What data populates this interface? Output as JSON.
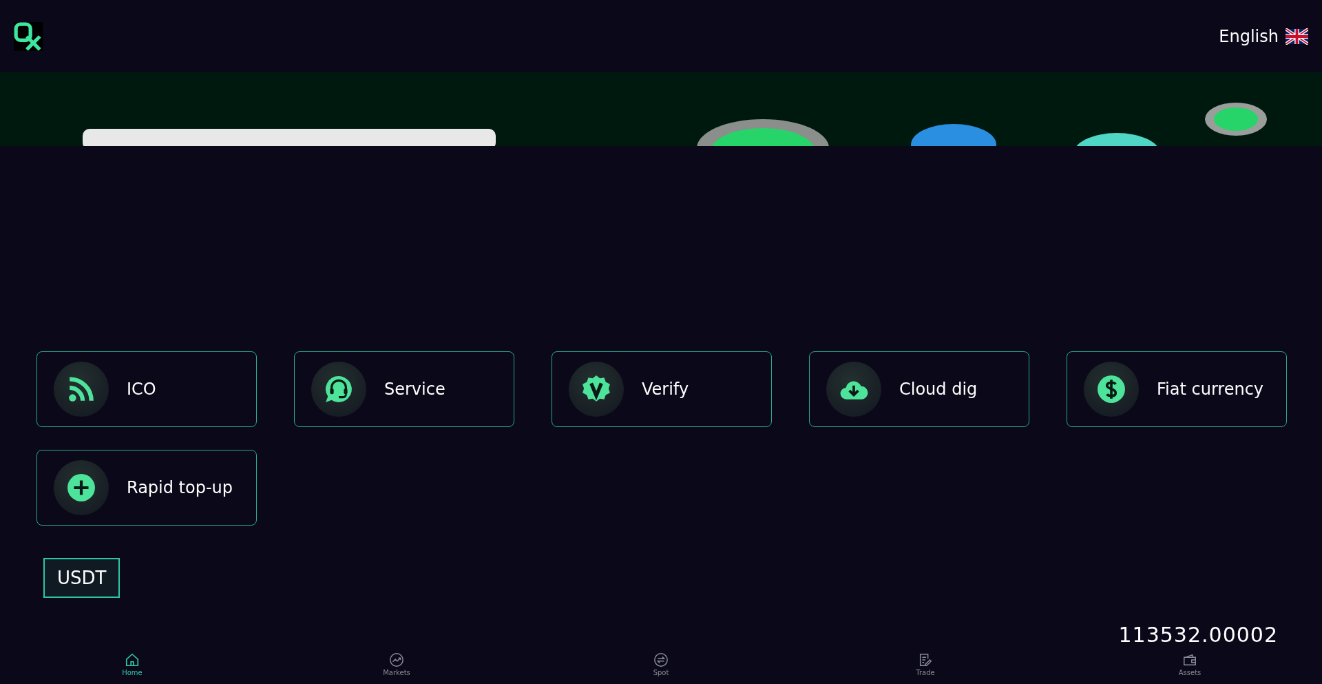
{
  "header": {
    "language": "English"
  },
  "shortcuts": [
    {
      "kind": "rss",
      "label": "ICO"
    },
    {
      "kind": "headset",
      "label": "Service"
    },
    {
      "kind": "badge",
      "label": "Verify"
    },
    {
      "kind": "cloud",
      "label": "Cloud dig"
    },
    {
      "kind": "dollar",
      "label": "Fiat currency"
    },
    {
      "kind": "plus",
      "label": "Rapid top-up"
    }
  ],
  "market_tabs": [
    {
      "label": "USDT",
      "selected": true
    }
  ],
  "ticker": {
    "price": "113532.00002"
  },
  "bottom_nav": [
    {
      "kind": "home",
      "label": "Home",
      "selected": true
    },
    {
      "kind": "markets",
      "label": "Markets",
      "selected": false
    },
    {
      "kind": "spot",
      "label": "Spot",
      "selected": false
    },
    {
      "kind": "trade",
      "label": "Trade",
      "selected": false
    },
    {
      "kind": "assets",
      "label": "Assets",
      "selected": false
    }
  ]
}
